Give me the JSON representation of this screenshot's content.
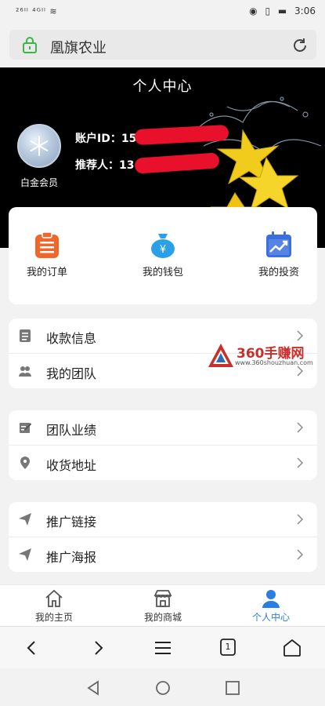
{
  "status": {
    "left": "²⁶ᴵˡ ⁴ᴳᴵˡ ≋",
    "time": "3:06",
    "battery": "battery-icon"
  },
  "url_bar": {
    "title": "凰旗农业"
  },
  "header": {
    "title": "个人中心",
    "member_level": "白金会员",
    "account_id_label": "账户ID：",
    "account_id_value": "15",
    "referrer_label": "推荐人：",
    "referrer_value": "13"
  },
  "shortcuts": [
    {
      "label": "我的订单",
      "icon": "order-icon"
    },
    {
      "label": "我的钱包",
      "icon": "wallet-icon"
    },
    {
      "label": "我的投资",
      "icon": "investment-icon"
    }
  ],
  "menu_group1": [
    {
      "label": "收款信息",
      "icon": "payment-info-icon"
    },
    {
      "label": "我的团队",
      "icon": "team-icon"
    }
  ],
  "menu_group2": [
    {
      "label": "团队业绩",
      "icon": "performance-icon"
    },
    {
      "label": "收货地址",
      "icon": "location-icon"
    }
  ],
  "menu_group3": [
    {
      "label": "推广链接",
      "icon": "send-icon"
    },
    {
      "label": "推广海报",
      "icon": "send-icon"
    }
  ],
  "watermark": {
    "text": "360手赚网",
    "url": "www.360shouzhuan.com"
  },
  "tabs": [
    {
      "label": "我的主页",
      "icon": "home-icon"
    },
    {
      "label": "我的商城",
      "icon": "store-icon"
    },
    {
      "label": "个人中心",
      "icon": "person-icon",
      "active": true
    }
  ],
  "browser": {
    "tab_count": "1"
  },
  "colors": {
    "accent": "#2b7de0",
    "header_bg": "#000000",
    "redaction": "#e8102a",
    "order": "#f0662b",
    "wallet": "#2aa0e8",
    "investment": "#3a6fe0"
  }
}
